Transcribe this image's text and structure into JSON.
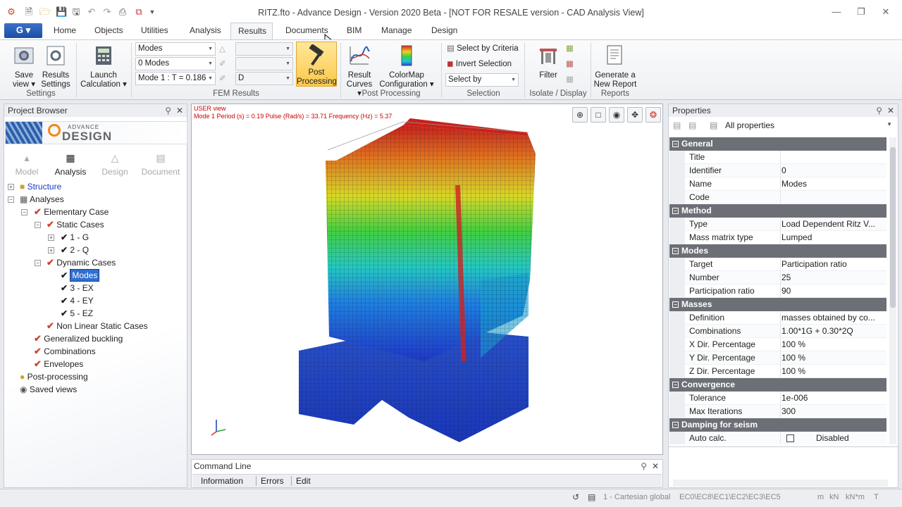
{
  "window": {
    "title": "RITZ.fto - Advance Design - Version 2020 Beta - [NOT FOR RESALE version - CAD Analysis View]"
  },
  "tabs": [
    "Home",
    "Objects",
    "Utilities",
    "Analysis",
    "Results",
    "Documents",
    "BIM",
    "Manage",
    "Design"
  ],
  "active_tab": "Results",
  "ribbon": {
    "settings": {
      "save_view": [
        "Save",
        "view"
      ],
      "results_settings": [
        "Results",
        "Settings"
      ],
      "label": "Settings"
    },
    "launch": [
      "Launch",
      "Calculation"
    ],
    "fem": {
      "select1": "Modes",
      "select2": "0 Modes",
      "select3": "Mode 1 : T = 0.186",
      "select6": "D",
      "post": [
        "Post",
        "Processing"
      ],
      "label": "FEM Results"
    },
    "post_processing": {
      "result_curves": [
        "Result",
        "Curves"
      ],
      "colormap": [
        "ColorMap",
        "Configuration"
      ],
      "label": "Post Processing"
    },
    "selection": {
      "by_criteria": "Select by Criteria",
      "invert": "Invert Selection",
      "select_by": "Select by",
      "label": "Selection"
    },
    "isolate": {
      "filter": "Filter",
      "label": "Isolate / Display"
    },
    "reports": {
      "generate": [
        "Generate a",
        "New Report"
      ],
      "label": "Reports"
    }
  },
  "project_browser": {
    "title": "Project Browser",
    "logo_small": "ADVANCE",
    "logo_big": "DESIGN",
    "modes": [
      "Model",
      "Analysis",
      "Design",
      "Document"
    ],
    "tree": [
      {
        "label": "Structure",
        "level": 0
      },
      {
        "label": "Analyses",
        "level": 0
      },
      {
        "label": "Elementary Case",
        "level": 1
      },
      {
        "label": "Static Cases",
        "level": 2
      },
      {
        "label": "1 - G",
        "level": 3
      },
      {
        "label": "2 - Q",
        "level": 3
      },
      {
        "label": "Dynamic Cases",
        "level": 2
      },
      {
        "label": "Modes",
        "level": 3
      },
      {
        "label": "3 - EX",
        "level": 3
      },
      {
        "label": "4 - EY",
        "level": 3
      },
      {
        "label": "5 - EZ",
        "level": 3
      },
      {
        "label": "Non Linear Static Cases",
        "level": 2
      },
      {
        "label": "Generalized buckling",
        "level": 1
      },
      {
        "label": "Combinations",
        "level": 1
      },
      {
        "label": "Envelopes",
        "level": 1
      },
      {
        "label": "Post-processing",
        "level": 0
      },
      {
        "label": "Saved views",
        "level": 0
      }
    ]
  },
  "viewport": {
    "view_name": "USER view",
    "mode_info": "Mode 1  Period (s) = 0.19  Pulse (Rad/s) = 33.71  Frequency (Hz) = 5.37"
  },
  "command_line": {
    "title": "Command Line",
    "tabs": [
      "Information",
      "Errors",
      "Edit"
    ]
  },
  "properties": {
    "title": "Properties",
    "filter": "All properties",
    "rows": [
      {
        "cat": "General"
      },
      {
        "name": "Title",
        "value": ""
      },
      {
        "name": "Identifier",
        "value": "0"
      },
      {
        "name": "Name",
        "value": "Modes"
      },
      {
        "name": "Code",
        "value": ""
      },
      {
        "cat": "Method"
      },
      {
        "name": "Type",
        "value": "Load Dependent Ritz V..."
      },
      {
        "name": "Mass matrix type",
        "value": "Lumped"
      },
      {
        "cat": "Modes"
      },
      {
        "name": "Target",
        "value": "Participation ratio"
      },
      {
        "name": "Number",
        "value": "25"
      },
      {
        "name": "Participation ratio",
        "value": "90"
      },
      {
        "cat": "Masses"
      },
      {
        "name": "Definition",
        "value": "masses obtained by co..."
      },
      {
        "name": "Combinations",
        "value": "1.00*1G + 0.30*2Q"
      },
      {
        "name": "X Dir. Percentage",
        "value": "100 %"
      },
      {
        "name": "Y Dir. Percentage",
        "value": "100 %"
      },
      {
        "name": "Z Dir. Percentage",
        "value": "100 %"
      },
      {
        "cat": "Convergence"
      },
      {
        "name": "Tolerance",
        "value": "1e-006"
      },
      {
        "name": "Max Iterations",
        "value": "300"
      },
      {
        "cat": "Damping for seism"
      },
      {
        "name": "Auto calc.",
        "value": "Disabled"
      }
    ]
  },
  "status": {
    "coord": "1 - Cartesian global",
    "codes": "EC0\\EC8\\EC1\\EC2\\EC3\\EC5",
    "units": [
      "m",
      "kN",
      "kN*m",
      "T"
    ]
  },
  "colors": {
    "accent": "#2a62b8",
    "category": "#6c6f76",
    "link": "#1a3cc0"
  }
}
